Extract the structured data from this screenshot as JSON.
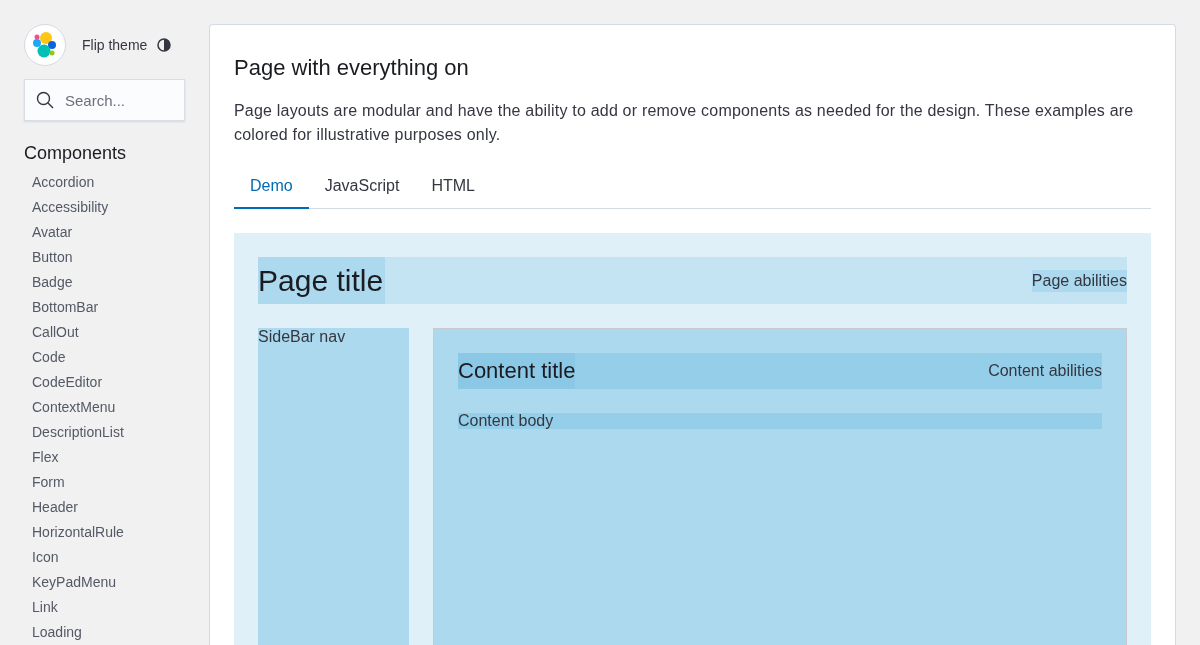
{
  "sidebar": {
    "theme_toggle": "Flip theme",
    "search": {
      "placeholder": "Search..."
    },
    "section_title": "Components",
    "items": [
      "Accordion",
      "Accessibility",
      "Avatar",
      "Button",
      "Badge",
      "BottomBar",
      "CallOut",
      "Code",
      "CodeEditor",
      "ContextMenu",
      "DescriptionList",
      "Flex",
      "Form",
      "Header",
      "HorizontalRule",
      "Icon",
      "KeyPadMenu",
      "Link",
      "Loading"
    ]
  },
  "main": {
    "title": "Page with everything on",
    "description": "Page layouts are modular and have the ability to add or remove components as needed for the design. These examples are colored for illustrative purposes only.",
    "tabs": [
      {
        "label": "Demo",
        "selected": true
      },
      {
        "label": "JavaScript",
        "selected": false
      },
      {
        "label": "HTML",
        "selected": false
      }
    ],
    "demo": {
      "page_title": "Page title",
      "page_abilities": "Page abilities",
      "sidebar_nav": "SideBar nav",
      "content_title": "Content title",
      "content_abilities": "Content abilities",
      "content_body": "Content body"
    }
  }
}
